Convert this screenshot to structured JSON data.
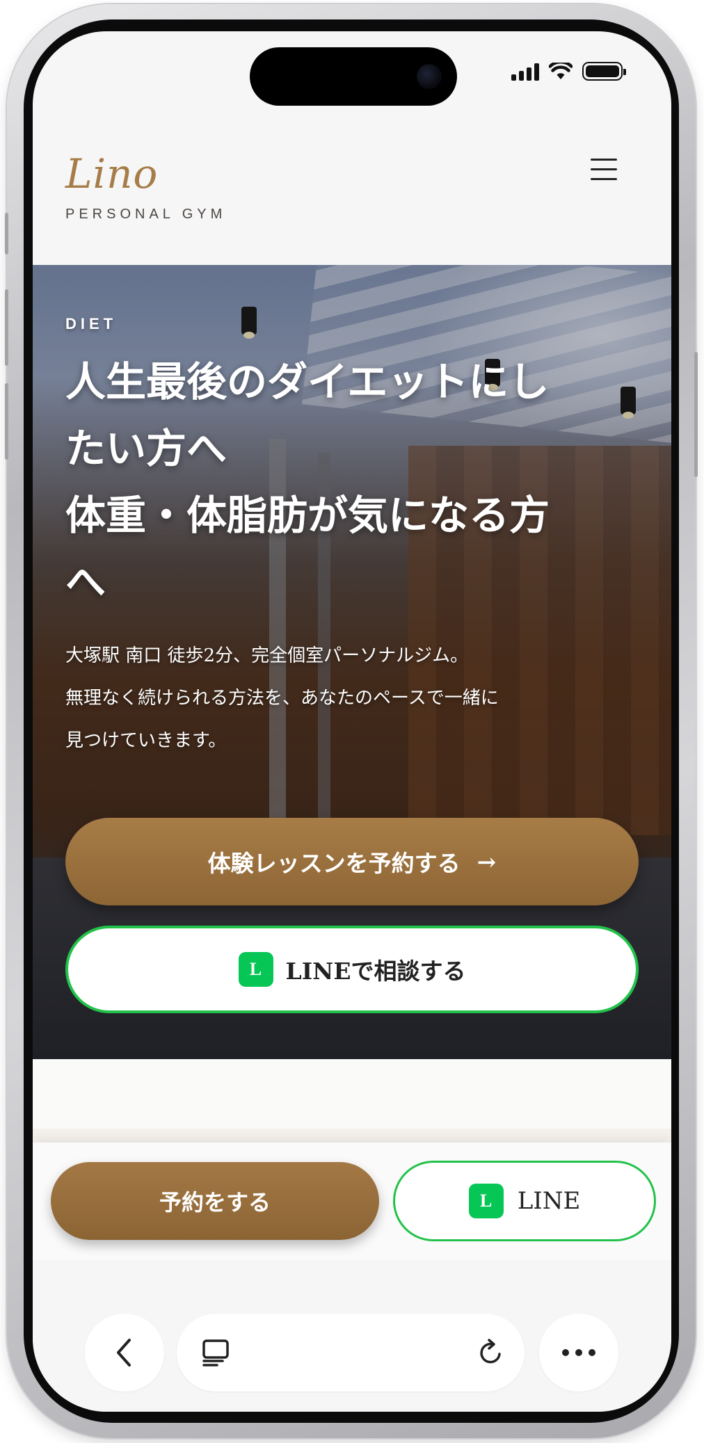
{
  "status_bar": {
    "icons": [
      "cellular-signal-icon",
      "wifi-icon",
      "battery-icon"
    ]
  },
  "header": {
    "logo_text": "Lino",
    "logo_subtitle": "PERSONAL GYM",
    "menu_icon": "hamburger-menu-icon"
  },
  "hero": {
    "eyebrow": "DIET",
    "title_lines": [
      "人生最後のダイエットにし",
      "たい方へ",
      "体重・体脂肪が気になる方",
      "へ"
    ],
    "lead_lines": [
      "大塚駅 南口 徒歩2分、完全個室パーソナルジム。",
      "無理なく続けられる方法を、あなたのペースで一緒に",
      "見つけていきます。"
    ],
    "reserve_button": {
      "label": "体験レッスンを予約する",
      "icon": "→"
    },
    "line_button": {
      "label": "LINEで相談する",
      "icon_letter": "L"
    }
  },
  "cta_bar": {
    "reserve_label": "予約をする",
    "line_label": "LINE",
    "line_icon_letter": "L"
  },
  "browser_toolbar": {
    "buttons": [
      "back-icon",
      "tabs-icon",
      "reload-icon",
      "more-icon"
    ]
  },
  "colors": {
    "brand_gold": "#a67c48",
    "button_brown": "#966d3b",
    "line_green": "#06c755",
    "line_border": "#22c24a"
  }
}
